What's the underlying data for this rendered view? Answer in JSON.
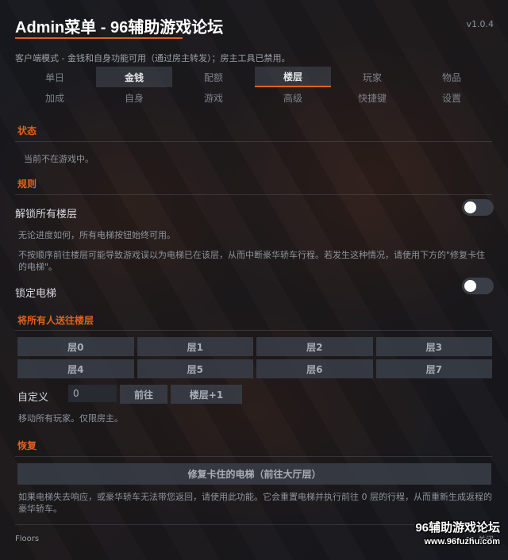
{
  "header": {
    "title": "Admin菜单 - 96辅助游戏论坛",
    "version": "v1.0.4",
    "mode_text": "客户端模式 - 金钱和自身功能可用（通过房主转发）；房主工具已禁用。"
  },
  "tabs": {
    "row1": [
      "单日",
      "金钱",
      "配额",
      "楼层",
      "玩家",
      "物品"
    ],
    "row2": [
      "加成",
      "自身",
      "游戏",
      "高级",
      "快捷键",
      "设置"
    ],
    "active": "楼层"
  },
  "status": {
    "title": "状态",
    "text": "当前不在游戏中。"
  },
  "rules": {
    "title": "规则",
    "unlock_label": "解锁所有楼层",
    "unlock_enabled": false,
    "unlock_desc1": "无论进度如何，所有电梯按钮始终可用。",
    "unlock_desc2_line1": "不按顺序前往楼层可能导致游戏误以为电梯已在该层，从而中断豪华轿车行程。若发生这种情况，请使用下方的\"修复卡住",
    "unlock_desc2_line2": "的电梯\"。",
    "lock_label": "锁定电梯",
    "lock_enabled": false
  },
  "send": {
    "title": "将所有人送往楼层",
    "floors": [
      "层0",
      "层1",
      "层2",
      "层3",
      "层4",
      "层5",
      "层6",
      "层7"
    ],
    "custom_label": "自定义",
    "custom_value": "0",
    "go_label": "前往",
    "up_label": "楼层+1",
    "note": "移动所有玩家。仅限房主。"
  },
  "recover": {
    "title": "恢复",
    "button": "修复卡住的电梯（前往大厅层）",
    "desc_line1": "如果电梯失去响应，或豪华轿车无法带您返回，请使用此功能。它会重置电梯并执行前往 0 层的行程，从而重新生成返程的",
    "desc_line2": "豪华轿车。"
  },
  "footer": {
    "left": "Floors",
    "right": "F1 关闭"
  },
  "watermark": {
    "line1": "96辅助游戏论坛",
    "line2": "www.96fuzhu.com"
  },
  "colors": {
    "accent": "#e0621c",
    "background": "#1b1d22",
    "button": "#3a3e47"
  }
}
